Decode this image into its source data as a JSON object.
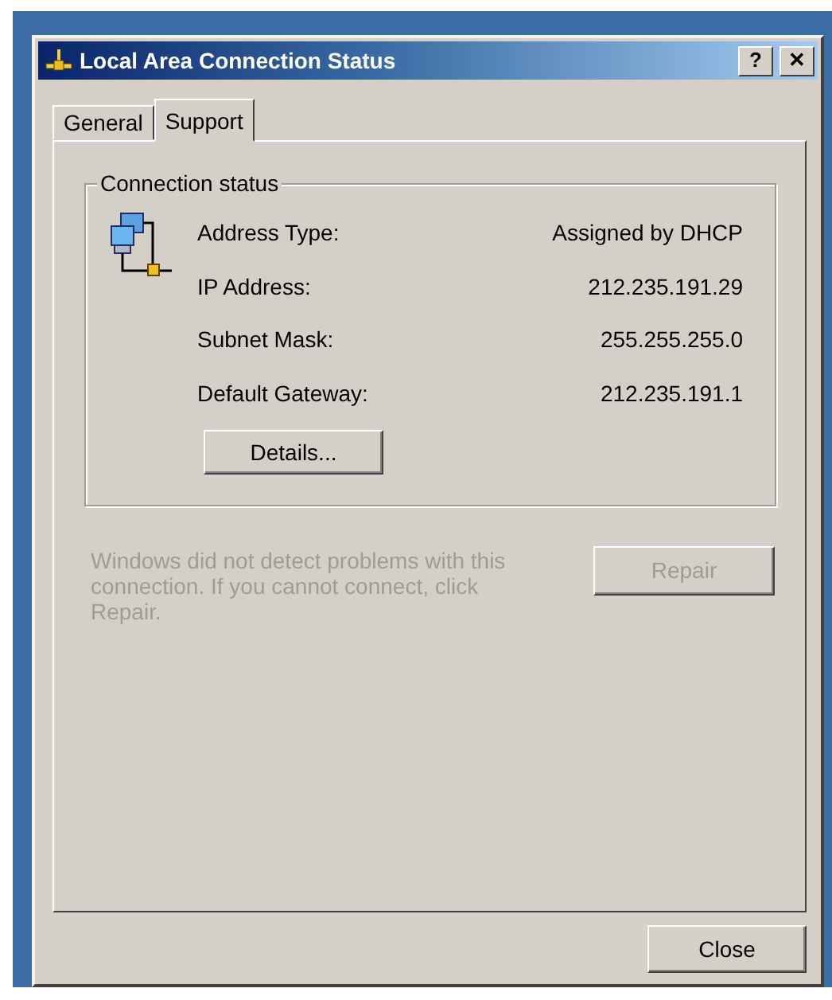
{
  "window": {
    "title": "Local Area Connection Status",
    "buttons": [
      "?",
      "✕"
    ]
  },
  "tabs": [
    {
      "label": "General",
      "selected": false
    },
    {
      "label": "Support",
      "selected": true
    }
  ],
  "group": {
    "title": "Connection status",
    "rows": [
      {
        "label": "Address Type:",
        "value": "Assigned by DHCP"
      },
      {
        "label": "IP Address:",
        "value": "212.235.191.29"
      },
      {
        "label": "Subnet Mask:",
        "value": "255.255.255.0"
      },
      {
        "label": "Default Gateway:",
        "value": "212.235.191.1"
      }
    ],
    "button": "Details..."
  },
  "message": {
    "text": "Windows did not detect problems with this connection. If you cannot connect, click Repair.",
    "disabled": true
  },
  "repair": {
    "label": "Repair",
    "disabled": true
  },
  "close": {
    "label": "Close"
  }
}
